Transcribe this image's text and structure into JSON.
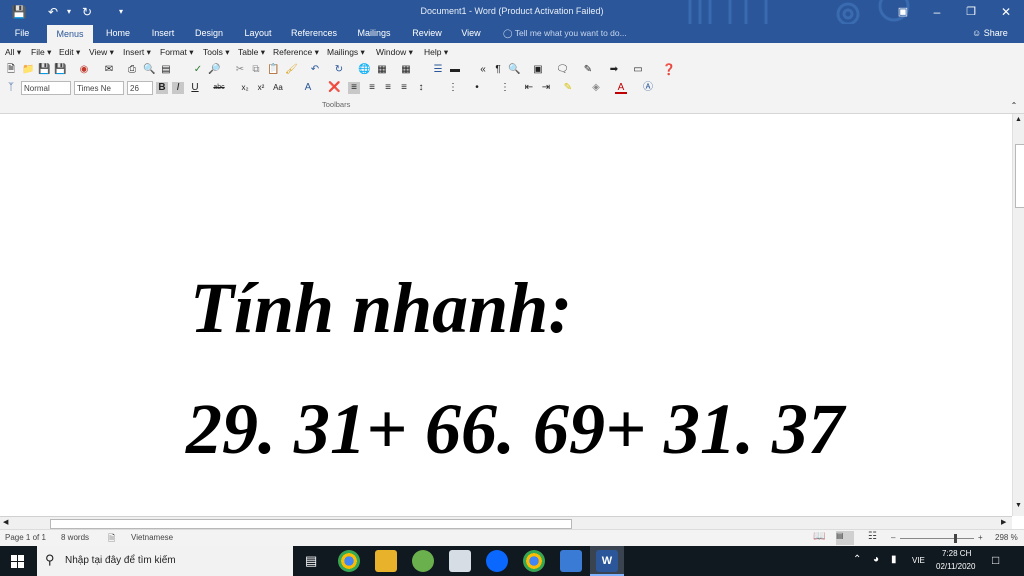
{
  "window": {
    "title": "Document1 - Word (Product Activation Failed)"
  },
  "tabs": [
    "File",
    "Menus",
    "Home",
    "Insert",
    "Design",
    "Layout",
    "References",
    "Mailings",
    "Review",
    "View"
  ],
  "tell_me": "Tell me what you want to do...",
  "share": "Share",
  "menus": [
    "All",
    "File",
    "Edit",
    "View",
    "Insert",
    "Format",
    "Tools",
    "Table",
    "Reference",
    "Mailings",
    "Window",
    "Help"
  ],
  "format": {
    "style": "Normal",
    "font": "Times Ne",
    "size": "26"
  },
  "group_label": "Toolbars",
  "document": {
    "line1": "Tính nhanh:",
    "line2": "29. 31+ 66. 69+ 31. 37"
  },
  "status": {
    "page": "Page 1 of 1",
    "words": "8 words",
    "language": "Vietnamese",
    "zoom": "298 %"
  },
  "taskbar": {
    "search_placeholder": "Nhập tại đây để tìm kiếm",
    "ime": "VIE",
    "time": "7:28 CH",
    "date": "02/11/2020"
  },
  "colors": {
    "accent": "#2b579a",
    "taskbar": "#101820"
  }
}
